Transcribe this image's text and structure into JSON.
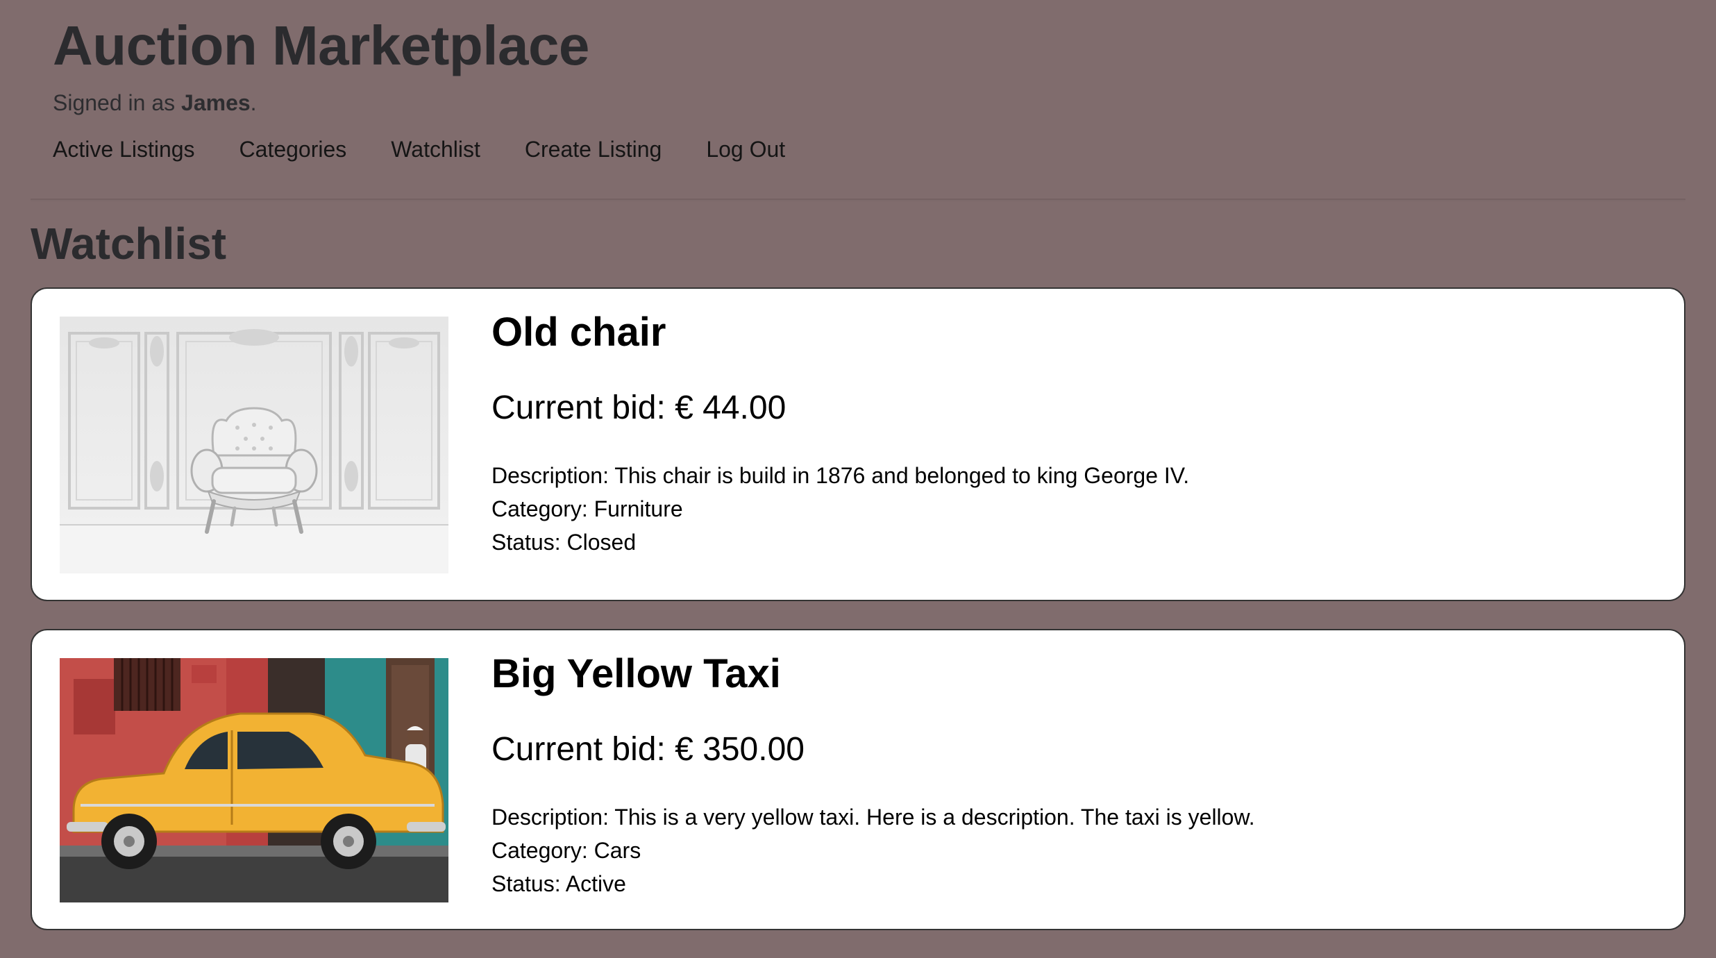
{
  "app": {
    "title": "Auction Marketplace",
    "signed_in_prefix": "Signed in as ",
    "username": "James",
    "signed_in_suffix": "."
  },
  "nav": [
    {
      "label": "Active Listings"
    },
    {
      "label": "Categories"
    },
    {
      "label": "Watchlist"
    },
    {
      "label": "Create Listing"
    },
    {
      "label": "Log Out"
    }
  ],
  "page": {
    "title": "Watchlist"
  },
  "listings": [
    {
      "title": "Old chair",
      "bid": "Current bid: € 44.00",
      "description": "Description: This chair is build in 1876 and belonged to king George IV.",
      "category": "Category: Furniture",
      "status": "Status: Closed",
      "image": "antique-white-armchair-photo"
    },
    {
      "title": "Big Yellow Taxi",
      "bid": "Current bid: € 350.00",
      "description": "Description: This is a very yellow taxi. Here is a description. The taxi is yellow.",
      "category": "Category: Cars",
      "status": "Status: Active",
      "image": "yellow-taxi-photo"
    }
  ],
  "colors": {
    "background": "#806c6d",
    "card": "#ffffff",
    "taxi": "#f2b233"
  }
}
